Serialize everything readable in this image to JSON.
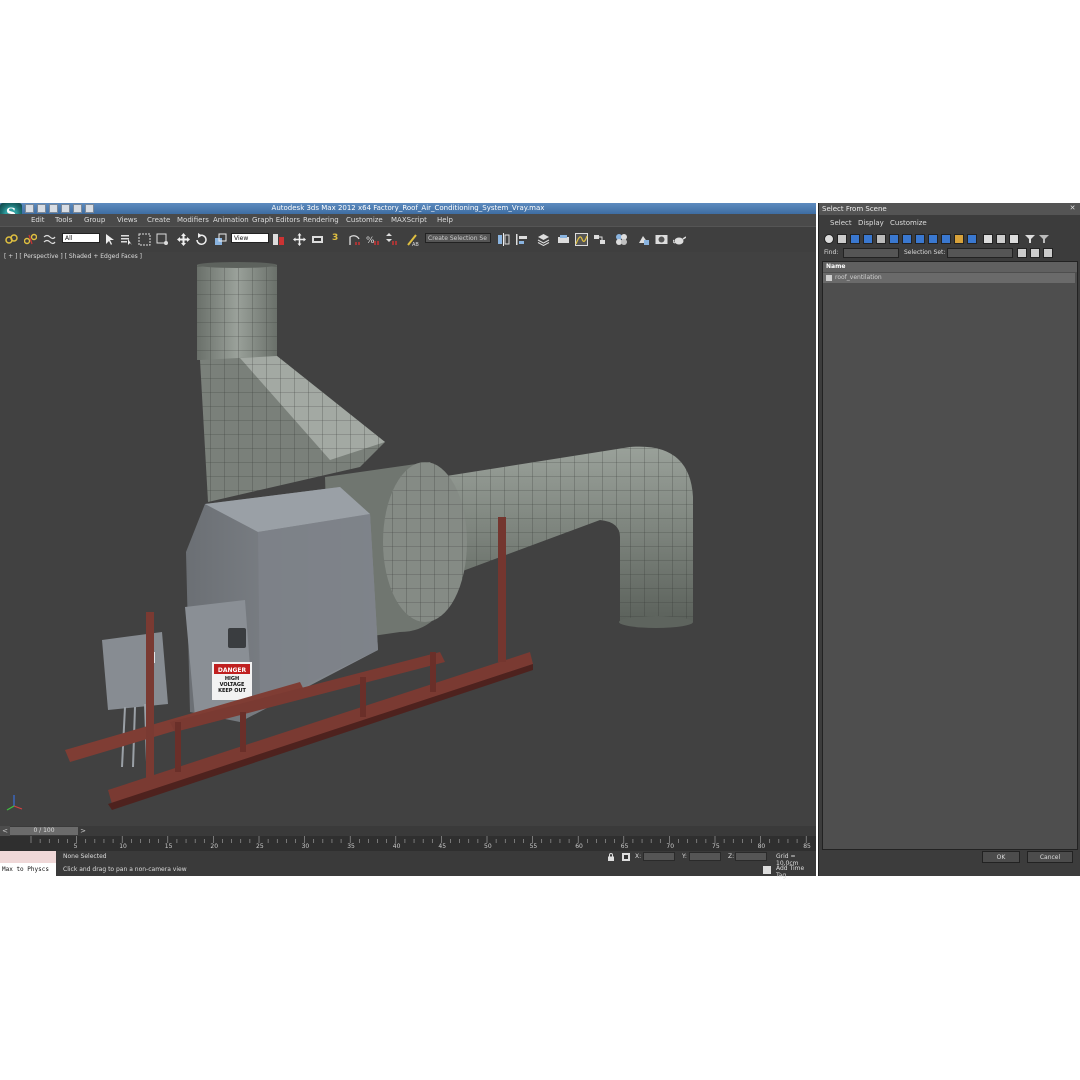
{
  "app": {
    "title": "Autodesk 3ds Max  2012 x64      Factory_Roof_Air_Conditioning_System_Vray.max",
    "logo_letter": "S",
    "menu": [
      "Edit",
      "Tools",
      "Group",
      "Views",
      "Create",
      "Modifiers",
      "Animation",
      "Graph Editors",
      "Rendering",
      "Customize",
      "MAXScript",
      "Help"
    ]
  },
  "toolbar": {
    "selection_filter": "All",
    "reference_coord": "View",
    "named_selection_set": "Create Selection Se",
    "snap_label": "3",
    "icons": [
      "select-link-icon",
      "unlink-icon",
      "bind-spacewarp-icon",
      "select-object-icon",
      "select-by-name-icon",
      "rect-region-icon",
      "window-crossing-icon",
      "move-icon",
      "rotate-icon",
      "scale-icon",
      "pivot-icon",
      "select-manipulate-icon",
      "keyboard-shortcut-icon",
      "snap-toggle-icon",
      "angle-snap-icon",
      "percent-snap-icon",
      "spinner-snap-icon",
      "edit-named-sets-icon",
      "mirror-icon",
      "align-icon",
      "layer-manager-icon",
      "graphite-icon",
      "curve-editor-icon",
      "schematic-view-icon",
      "material-editor-icon",
      "render-setup-icon",
      "rendered-frame-icon",
      "render-icon",
      "teapot-icon"
    ]
  },
  "viewport": {
    "label": "[ + ] [ Perspective ] [ Shaded + Edged Faces ]",
    "danger_sign": "DANGER",
    "danger_sub": "HIGH VOLTAGE KEEP OUT"
  },
  "timeline": {
    "frame_display": "0 / 100",
    "ticks": [
      "5",
      "10",
      "15",
      "20",
      "25",
      "30",
      "35",
      "40",
      "45",
      "50",
      "55",
      "60",
      "65",
      "70",
      "75",
      "80",
      "85"
    ]
  },
  "status": {
    "listener": "Max to Physcs",
    "selection": "None Selected",
    "prompt": "Click and drag to pan a non-camera view",
    "x_label": "X:",
    "y_label": "Y:",
    "z_label": "Z:",
    "grid": "Grid = 10,0cm",
    "add_time_tag": "Add Time Tag"
  },
  "dialog": {
    "title": "Select From Scene",
    "close": "✕",
    "menu": [
      "Select",
      "Display",
      "Customize"
    ],
    "find_label": "Find:",
    "selection_set_label": "Selection Set:",
    "column_header": "Name",
    "items": [
      "roof_ventilation"
    ],
    "ok": "OK",
    "cancel": "Cancel"
  },
  "colors": {
    "title_bar": "#4a7ab0",
    "viewport_bg": "#414141",
    "steel_frame": "#7a3a32",
    "duct": "#7d847c"
  }
}
